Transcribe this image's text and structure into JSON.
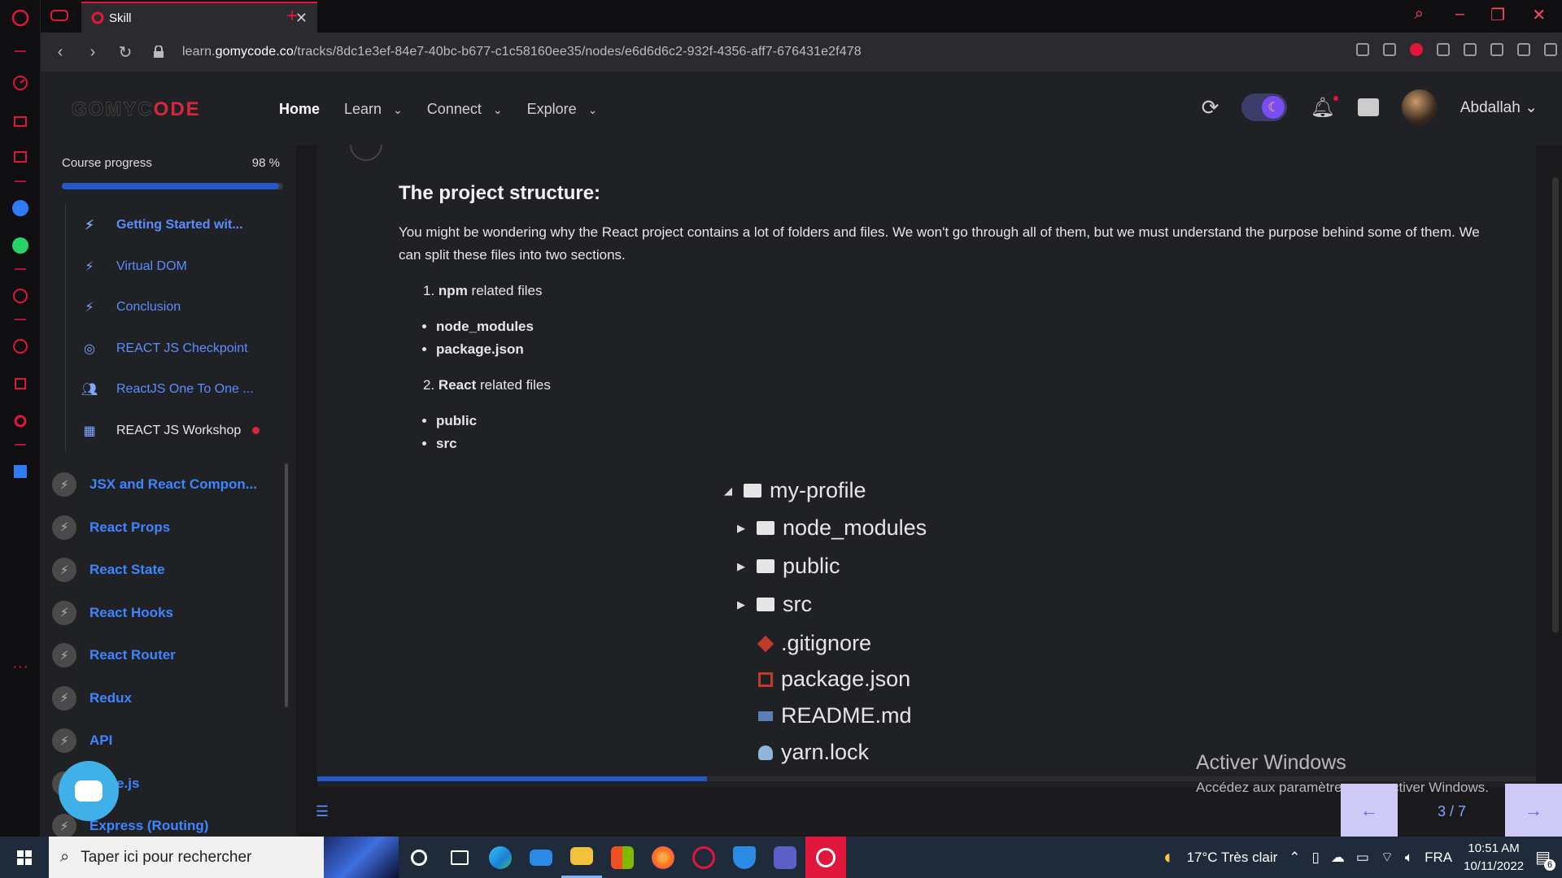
{
  "browser": {
    "tab_title": "Skill",
    "url_prefix": "learn.",
    "url_domain": "gomycode.co",
    "url_path": "/tracks/8dc1e3ef-84e7-40bc-b677-c1c58160ee35/nodes/e6d6d6c2-932f-4356-aff7-676431e2f478"
  },
  "header": {
    "logo_part1": "GOMYC",
    "logo_part2": "ODE",
    "nav": {
      "home": "Home",
      "learn": "Learn",
      "connect": "Connect",
      "explore": "Explore"
    },
    "username": "Abdallah"
  },
  "sidebar": {
    "progress_label": "Course progress",
    "progress_value": 0.98,
    "progress_text": "98 %",
    "lessons": [
      {
        "label": "Getting Started wit...",
        "icon": "bolt-icon"
      },
      {
        "label": "Virtual DOM",
        "icon": "bolt-icon"
      },
      {
        "label": "Conclusion",
        "icon": "bolt-icon"
      },
      {
        "label": "REACT JS Checkpoint",
        "icon": "target-icon"
      },
      {
        "label": "ReactJS One To One ...",
        "icon": "people-icon"
      },
      {
        "label": "REACT JS Workshop",
        "icon": "workshop-icon"
      }
    ],
    "modules": [
      "JSX and React Compon...",
      "React Props",
      "React State",
      "React Hooks",
      "React Router",
      "Redux",
      "API",
      "Node.js",
      "Express (Routing)"
    ]
  },
  "content": {
    "heading": "The project structure:",
    "paragraph": "You might be wondering why the React project contains a lot of folders and files. We won't go through all of them, but we must understand the purpose behind some of them. We can split these files into two sections.",
    "section1_num": "1.",
    "section1_bold": "npm",
    "section1_rest": " related files",
    "section1_items": [
      "node_modules",
      "package.json"
    ],
    "section2_num": "2.",
    "section2_bold": "React",
    "section2_rest": " related files",
    "section2_items": [
      "public",
      "src"
    ],
    "tree": {
      "root": "my-profile",
      "folders": [
        "node_modules",
        "public",
        "src"
      ],
      "files": [
        ".gitignore",
        "package.json",
        "README.md",
        "yarn.lock"
      ]
    },
    "content_progress": 0.32,
    "page_counter": "3 / 7"
  },
  "watermark": {
    "line1": "Activer Windows",
    "line2": "Accédez aux paramètres pour activer Windows."
  },
  "taskbar": {
    "search_placeholder": "Taper ici pour rechercher",
    "weather": "17°C  Très clair",
    "language": "FRA",
    "time": "10:51 AM",
    "date": "10/11/2022",
    "notification_count": "6"
  },
  "colors": {
    "accent_blue": "#2557c7",
    "link_blue": "#3d86ff",
    "opera_red": "#e0163a",
    "toggle_purple": "#7b4cf2"
  }
}
